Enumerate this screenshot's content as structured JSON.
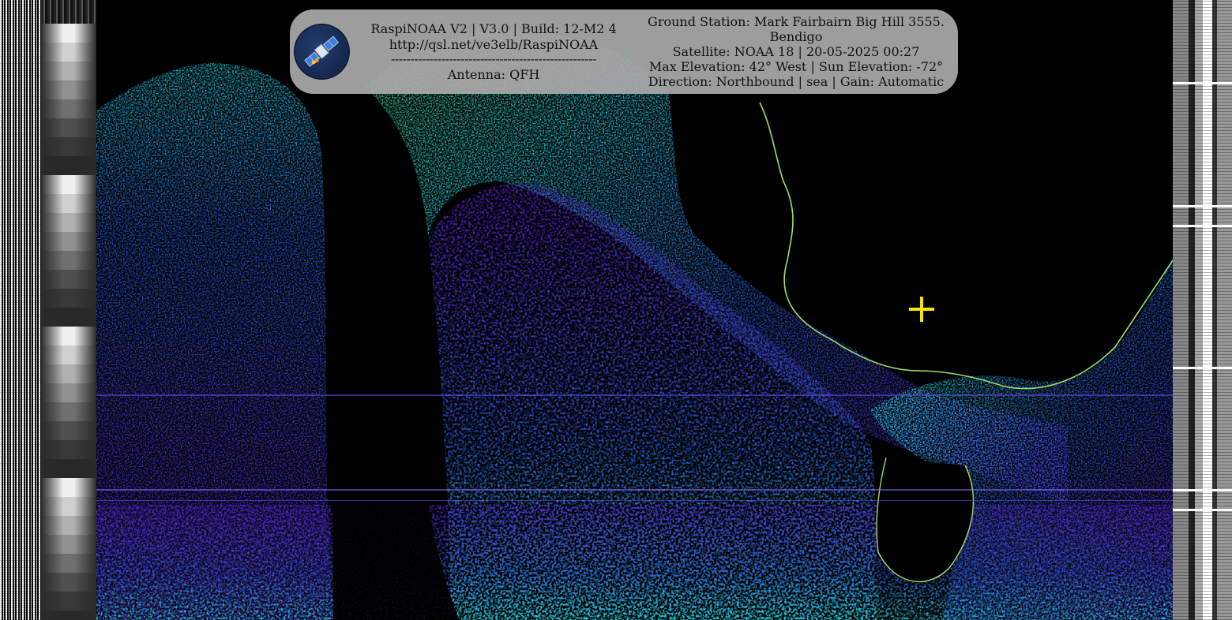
{
  "overlay": {
    "app_line": "RaspiNOAA V2 | V3.0 | Build: 12-M2 4",
    "url": "http://qsl.net/ve3elb/RaspiNOAA",
    "divider": "-----------------------------------------------------",
    "antenna": "Antenna: QFH",
    "ground_station_line1": "Ground Station: Mark Fairbairn Big Hill 3555.",
    "ground_station_line2": "Bendigo",
    "satellite_line": "Satellite: NOAA 18 | 20-05-2025 00:27",
    "elevation_line": "Max Elevation: 42° West | Sun Elevation: -72°",
    "direction_line": "Direction: Northbound | sea | Gain: Automatic"
  },
  "logo": {
    "icon": "satellite-icon"
  },
  "marker": {
    "icon": "crosshair-icon",
    "color": "#f2e600"
  },
  "palette": {
    "deep": "#5a1fd0",
    "blue": "#2f5fe0",
    "cyan": "#29d7e8",
    "green": "#5fe08a",
    "yellow": "#d6e34a",
    "land_edge": "#9be06a"
  }
}
